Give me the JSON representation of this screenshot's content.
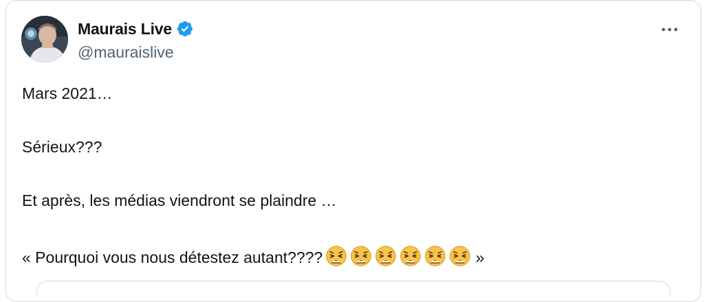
{
  "tweet": {
    "author": {
      "display_name": "Maurais Live",
      "handle": "@mauraislive",
      "verified_color": "#1d9bf0"
    },
    "more_icon": "more-horizontal-icon",
    "lines": [
      "Mars 2021…",
      "Sérieux???",
      "Et après, les médias viendront se plaindre …",
      "« Pourquoi vous nous détestez autant????"
    ],
    "closing_quote": " »",
    "emoji": {
      "name": "weary-face-emoji",
      "count": 6
    }
  }
}
